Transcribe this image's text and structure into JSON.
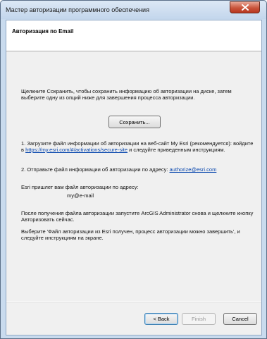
{
  "window": {
    "title": "Мастер авторизации программного обеспечения"
  },
  "header": {
    "title": "Авторизация по Email"
  },
  "body": {
    "intro": "Щелкните Сохранить, чтобы сохранить информацию об авторизации на диске, затем выберите одну из опций ниже для завершения процесса авторизации.",
    "save_label": "Сохранить...",
    "step1_prefix": "1.  Загрузите файл информации об авторизации на веб-сайт My Esri (рекомендуется): войдите в ",
    "step1_link": "https://my.esri.com/#/activations/secure-site",
    "step1_suffix": " и следуйте приведенным инструкциям.",
    "step2_prefix": "2.  Отправьте файл информации об авторизации по адресу: ",
    "step2_link": "authorize@esri.com",
    "esri_send": "Esri пришлет вам файл авторизации по адресу:",
    "email_value": "my@e-mail",
    "after_receive": "После получения файла авторизации запустите ArcGIS Administrator снова и щелкните кнопку Авторизовать сейчас.",
    "choose_option": "Выберите 'Файл авторизации из Esri получен, процесс авторизации можно завершить', и следуйте инструкциям на экране."
  },
  "footer": {
    "back_label": "< Back",
    "finish_label": "Finish",
    "cancel_label": "Cancel"
  }
}
